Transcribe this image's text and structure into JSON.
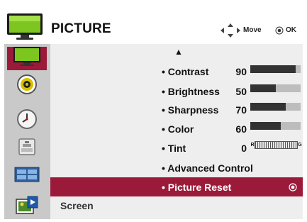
{
  "header": {
    "title": "PICTURE",
    "move_label": "Move",
    "ok_label": "OK"
  },
  "sidebar": {
    "items": [
      {
        "icon": "tv-picture-icon",
        "selected": true
      },
      {
        "icon": "speaker-audio-icon",
        "selected": false
      },
      {
        "icon": "clock-time-icon",
        "selected": false
      },
      {
        "icon": "toolbox-option-icon",
        "selected": false
      },
      {
        "icon": "screen-grid-icon",
        "selected": false
      },
      {
        "icon": "photo-media-icon",
        "selected": false
      }
    ]
  },
  "menu": {
    "up_arrow": "▲",
    "options": [
      {
        "label": "• Contrast",
        "value": "90",
        "level": 90
      },
      {
        "label": "• Brightness",
        "value": "50",
        "level": 50
      },
      {
        "label": "• Sharpness",
        "value": "70",
        "level": 70
      },
      {
        "label": "• Color",
        "value": "60",
        "level": 60
      },
      {
        "label": "• Tint",
        "value": "0",
        "tint_left": "R",
        "tint_right": "G"
      },
      {
        "label": "• Advanced Control"
      }
    ],
    "selected_item": "• Picture Reset"
  },
  "footer": {
    "label": "Screen"
  },
  "colors": {
    "accent": "#9c1a39",
    "panel": "#eeeeee",
    "sidebar": "#c9c9c9",
    "bar_fill": "#333333",
    "bar_track": "#bdbdbd"
  }
}
